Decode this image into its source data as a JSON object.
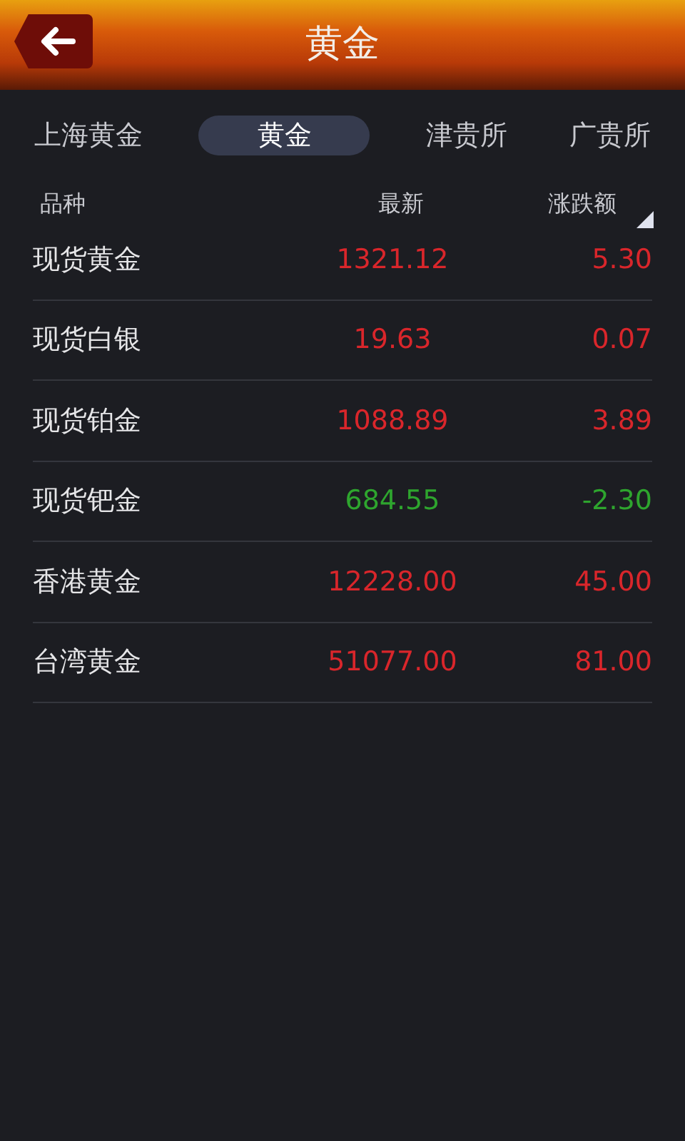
{
  "header": {
    "title": "黄金"
  },
  "tabs": [
    {
      "label": "上海黄金",
      "selected": false
    },
    {
      "label": "黄金",
      "selected": true
    },
    {
      "label": "津贵所",
      "selected": false
    },
    {
      "label": "广贵所",
      "selected": false
    }
  ],
  "table": {
    "columns": [
      "品种",
      "最新",
      "涨跌额"
    ],
    "rows": [
      {
        "name": "现货黄金",
        "latest": "1321.12",
        "change": "5.30",
        "color": "#d9262b"
      },
      {
        "name": "现货白银",
        "latest": "19.63",
        "change": "0.07",
        "color": "#d9262b"
      },
      {
        "name": "现货铂金",
        "latest": "1088.89",
        "change": "3.89",
        "color": "#d9262b"
      },
      {
        "name": "现货钯金",
        "latest": "684.55",
        "change": "-2.30",
        "color": "#2ea52e"
      },
      {
        "name": "香港黄金",
        "latest": "12228.00",
        "change": "45.00",
        "color": "#d9262b"
      },
      {
        "name": "台湾黄金",
        "latest": "51077.00",
        "change": "81.00",
        "color": "#d9262b"
      }
    ]
  }
}
